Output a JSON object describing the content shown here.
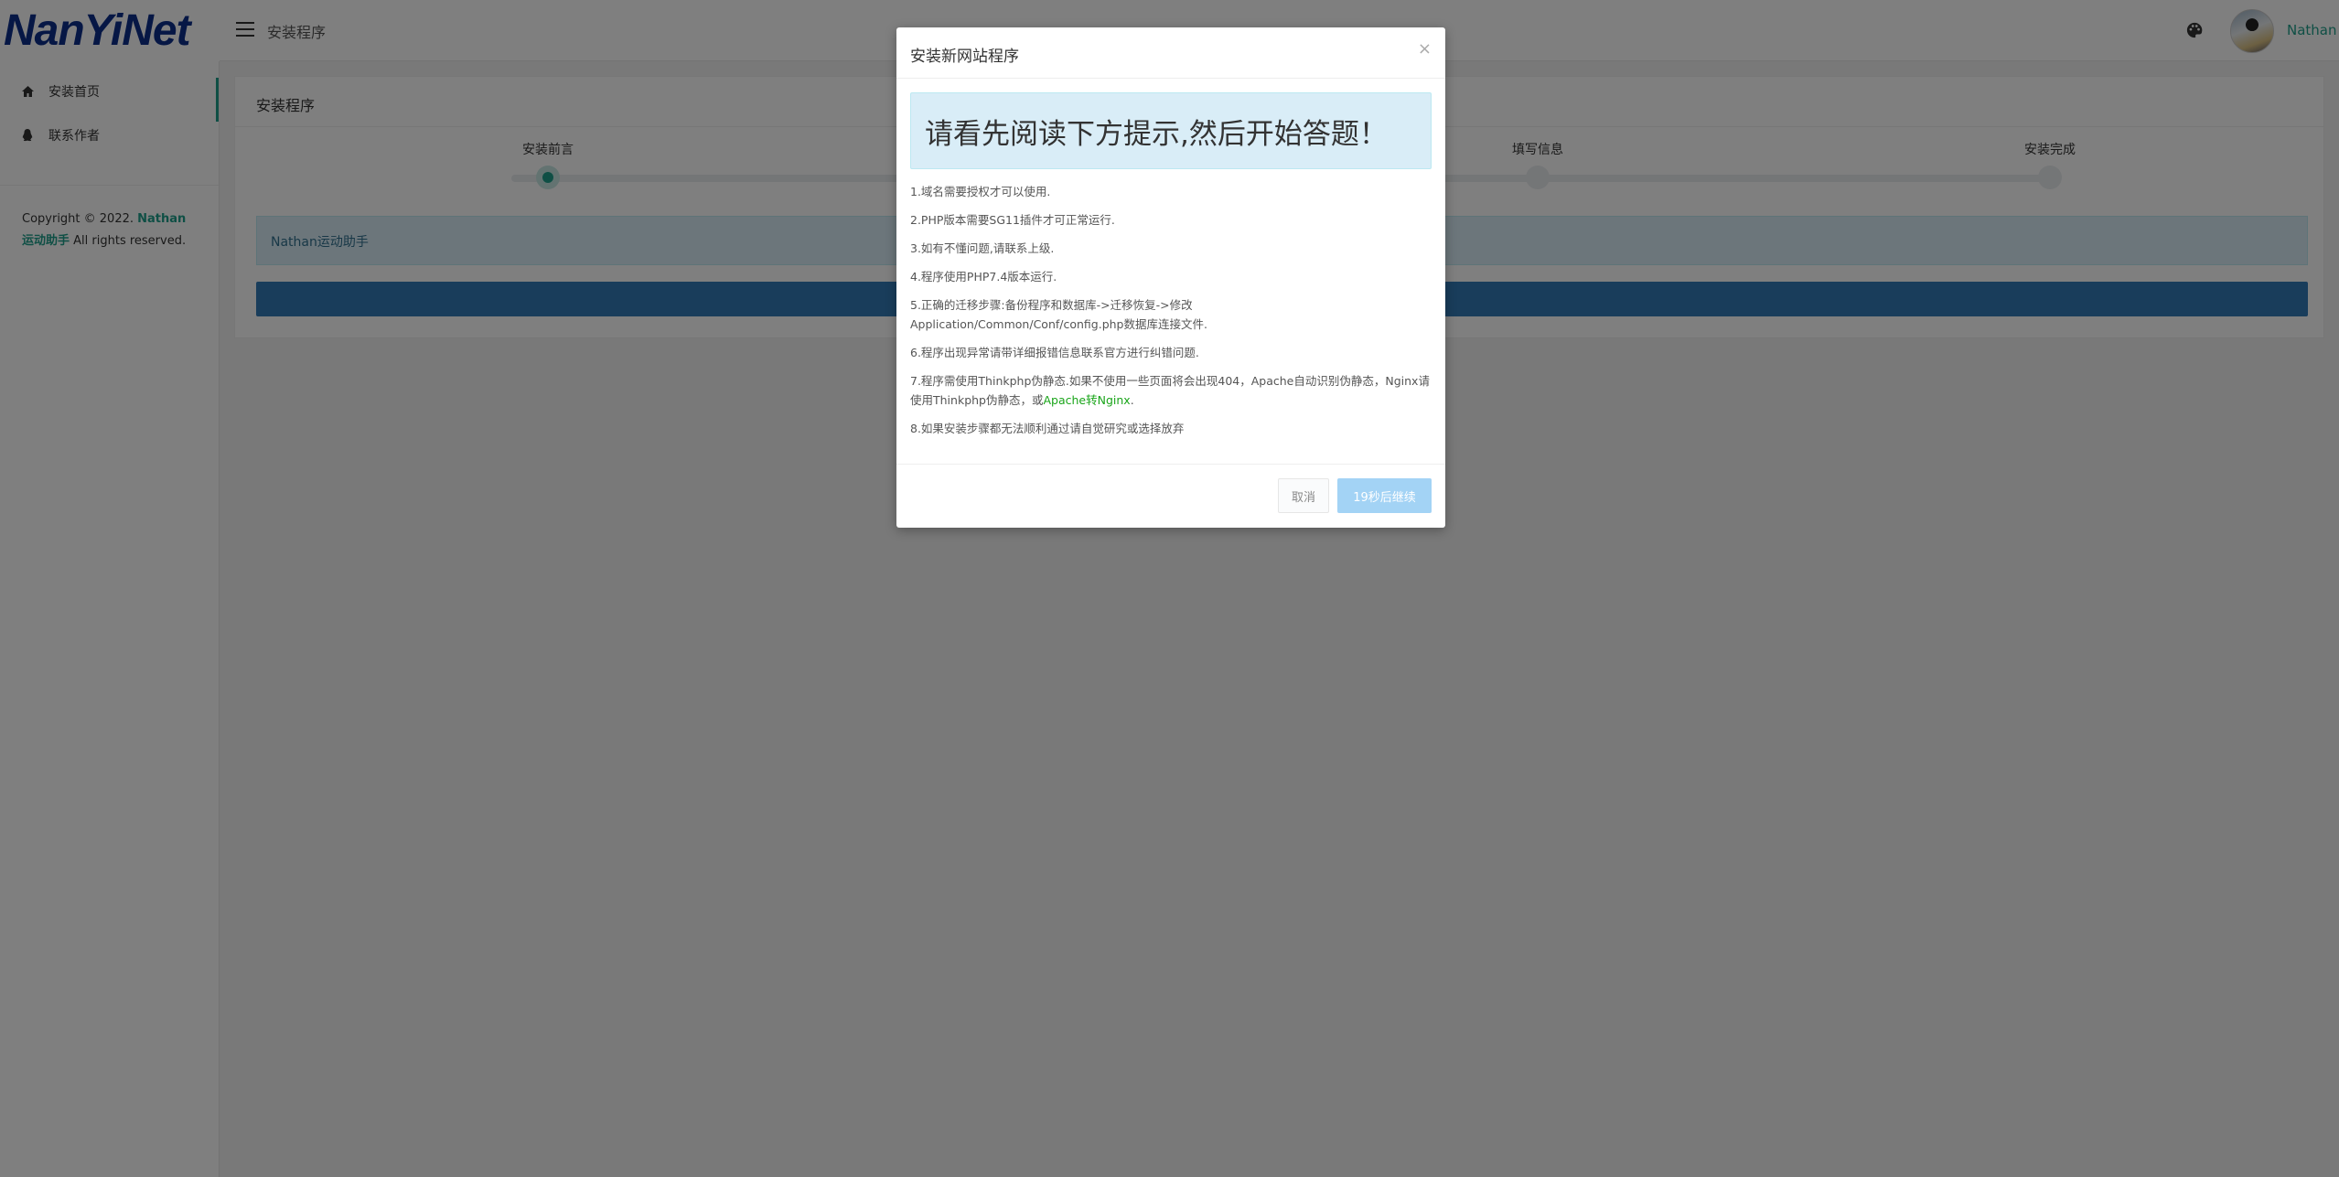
{
  "header": {
    "logo_text": "NanYiNet",
    "title": "安装程序",
    "user_name": "Nathan"
  },
  "sidebar": {
    "items": [
      {
        "label": "安装首页",
        "icon": "home-icon",
        "active": true
      },
      {
        "label": "联系作者",
        "icon": "qq-penguin-icon",
        "active": false
      }
    ],
    "copyright": {
      "prefix": "Copyright © 2022. ",
      "link_text": "Nathan运动助手",
      "suffix": " All rights reserved."
    }
  },
  "card": {
    "title": "安装程序",
    "steps": [
      {
        "label": "安装前言",
        "active": true
      },
      {
        "label": "",
        "active": false
      },
      {
        "label": "填写信息",
        "active": false
      },
      {
        "label": "安装完成",
        "active": false
      }
    ],
    "info_text": "Nathan运动助手"
  },
  "modal": {
    "title": "安装新网站程序",
    "close_symbol": "×",
    "alert_text": "请看先阅读下方提示,然后开始答题！",
    "notices": [
      "1.域名需要授权才可以使用.",
      "2.PHP版本需要SG11插件才可正常运行.",
      "3.如有不懂问题,请联系上级.",
      "4.程序使用PHP7.4版本运行.",
      "5.正确的迁移步骤:备份程序和数据库->迁移恢复->修改Application/Common/Conf/config.php数据库连接文件.",
      "6.程序出现异常请带详细报错信息联系官方进行纠错问题.",
      "7.程序需使用Thinkphp伪静态.如果不使用一些页面将会出现404，Apache自动识别伪静态，Nginx请使用Thinkphp伪静态，或",
      "8.如果安装步骤都无法顺利通过请自觉研究或选择放弃"
    ],
    "notice7_link": "Apache转Nginx",
    "notice7_tail": ".",
    "cancel_label": "取消",
    "continue_label": "19秒后继续",
    "countdown_seconds": 19
  },
  "colors": {
    "accent": "#1e9f8a",
    "logo": "#0c2e8a",
    "primary": "#337ab7",
    "alert_bg": "#d9edf7",
    "disabled_button": "#a3d3f5",
    "link_green": "#1aa51a"
  }
}
